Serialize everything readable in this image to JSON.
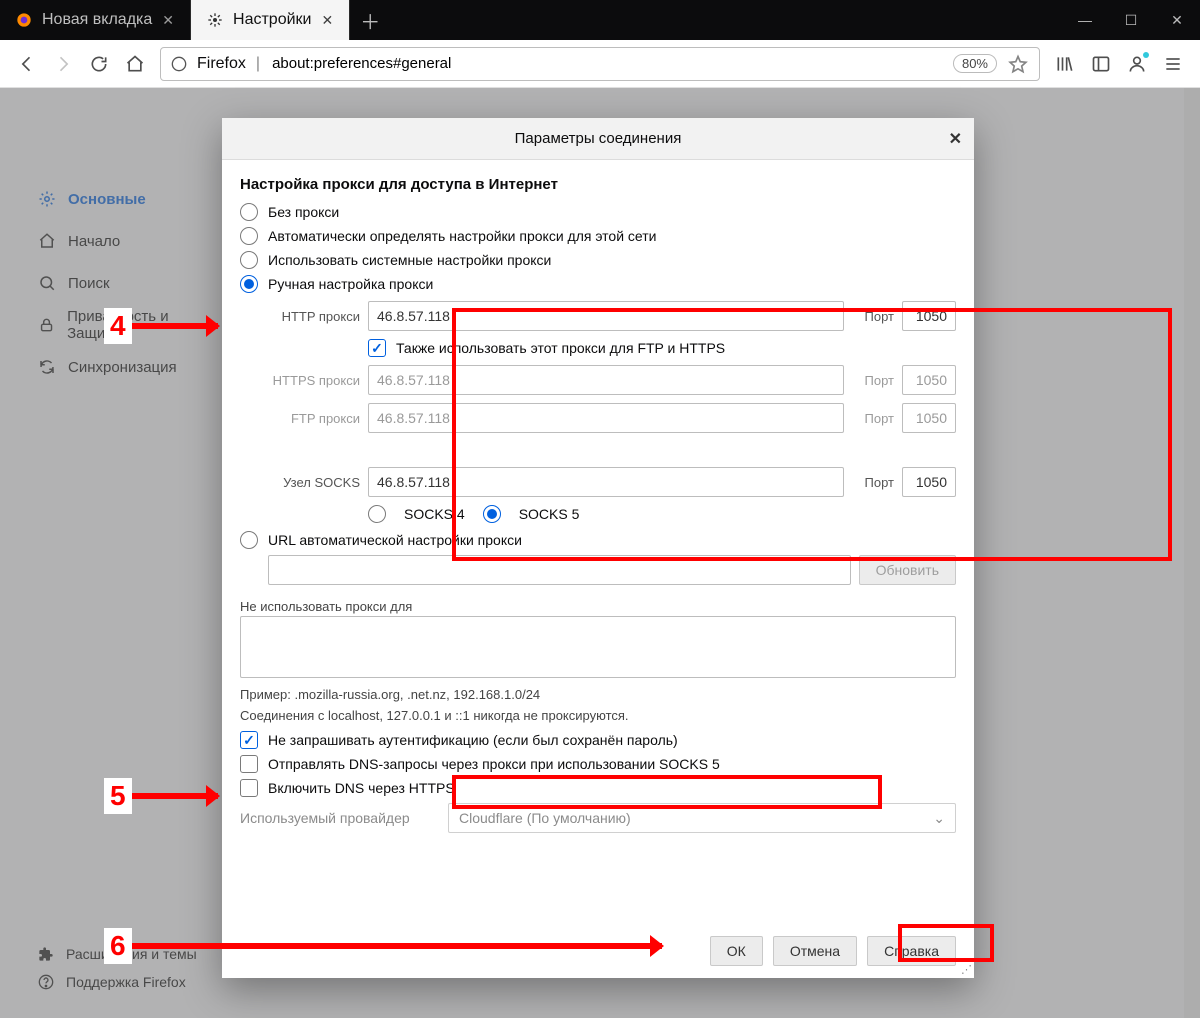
{
  "tabs": [
    {
      "label": "Новая вкладка"
    },
    {
      "label": "Настройки"
    }
  ],
  "urlbar": {
    "identity": "Firefox",
    "value": "about:preferences#general",
    "zoom": "80%"
  },
  "sidebar": {
    "items": [
      {
        "label": "Основные"
      },
      {
        "label": "Начало"
      },
      {
        "label": "Поиск"
      },
      {
        "label": "Приватность и Защита"
      },
      {
        "label": "Синхронизация"
      }
    ],
    "bottom": [
      {
        "label": "Расширения и темы"
      },
      {
        "label": "Поддержка Firefox"
      }
    ]
  },
  "dialog": {
    "title": "Параметры соединения",
    "section_heading": "Настройка прокси для доступа в Интернет",
    "radios": {
      "none": "Без прокси",
      "auto": "Автоматически определять настройки прокси для этой сети",
      "system": "Использовать системные настройки прокси",
      "manual": "Ручная настройка прокси",
      "pac": "URL автоматической настройки прокси"
    },
    "fields": {
      "http_label": "HTTP прокси",
      "https_label": "HTTPS прокси",
      "ftp_label": "FTP прокси",
      "socks_label": "Узел SOCKS",
      "port_label": "Порт",
      "http_host": "46.8.57.118",
      "http_port": "1050",
      "https_host": "46.8.57.118",
      "https_port": "1050",
      "ftp_host": "46.8.57.118",
      "ftp_port": "1050",
      "socks_host": "46.8.57.118",
      "socks_port": "1050",
      "also_ftp_https": "Также использовать этот прокси для FTP и HTTPS",
      "socks4": "SOCKS 4",
      "socks5": "SOCKS 5"
    },
    "pac_reload": "Обновить",
    "noproxy_heading": "Не использовать прокси для",
    "noproxy_example": "Пример: .mozilla-russia.org, .net.nz, 192.168.1.0/24",
    "noproxy_note": "Соединения с localhost, 127.0.0.1 и ::1 никогда не проксируются.",
    "chk_auth": "Не запрашивать аутентификацию (если был сохранён пароль)",
    "chk_dns": "Отправлять DNS-запросы через прокси при использовании SOCKS 5",
    "chk_doh": "Включить DNS через HTTPS",
    "provider_label": "Используемый провайдер",
    "provider_value": "Cloudflare (По умолчанию)",
    "buttons": {
      "ok": "ОК",
      "cancel": "Отмена",
      "help": "Справка"
    }
  },
  "callouts": {
    "c4": "4",
    "c5": "5",
    "c6": "6"
  }
}
